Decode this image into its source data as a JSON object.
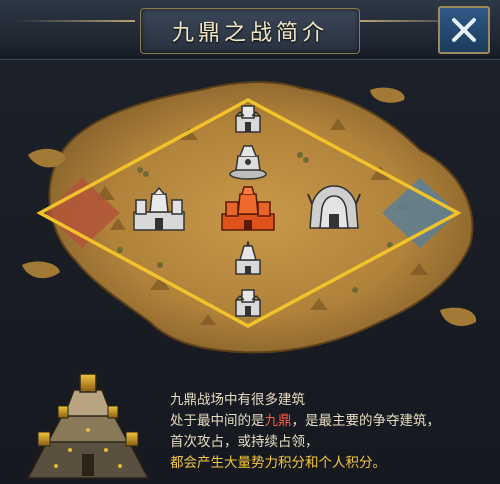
{
  "header": {
    "title": "九鼎之战简介",
    "close_icon": "close-x-icon"
  },
  "map": {
    "colors": {
      "border": "#f2c22b",
      "center_building": "#e0521c",
      "other_buildings": "#d8d8d8",
      "left_zone": "#b3553a",
      "right_zone": "#5c7f96",
      "terrain": "#b88a3e"
    },
    "buildings": [
      {
        "id": "top",
        "icon": "small-fort-icon"
      },
      {
        "id": "upper-middle",
        "icon": "tripod-cauldron-icon"
      },
      {
        "id": "center",
        "icon": "nine-tripod-castle-icon"
      },
      {
        "id": "west",
        "icon": "castle-icon"
      },
      {
        "id": "east",
        "icon": "demon-fortress-icon"
      },
      {
        "id": "lower-middle",
        "icon": "small-tower-icon"
      },
      {
        "id": "bottom",
        "icon": "small-fort-icon"
      }
    ]
  },
  "info": {
    "line1": "九鼎战场中有很多建筑",
    "line2_pre": "处于最中间的是",
    "line2_hl": "九鼎",
    "line2_post": "，是最主要的争夺建筑，",
    "line3": "首次攻占，或持续占领，",
    "line4": "都会产生大量势力积分和个人积分。"
  }
}
